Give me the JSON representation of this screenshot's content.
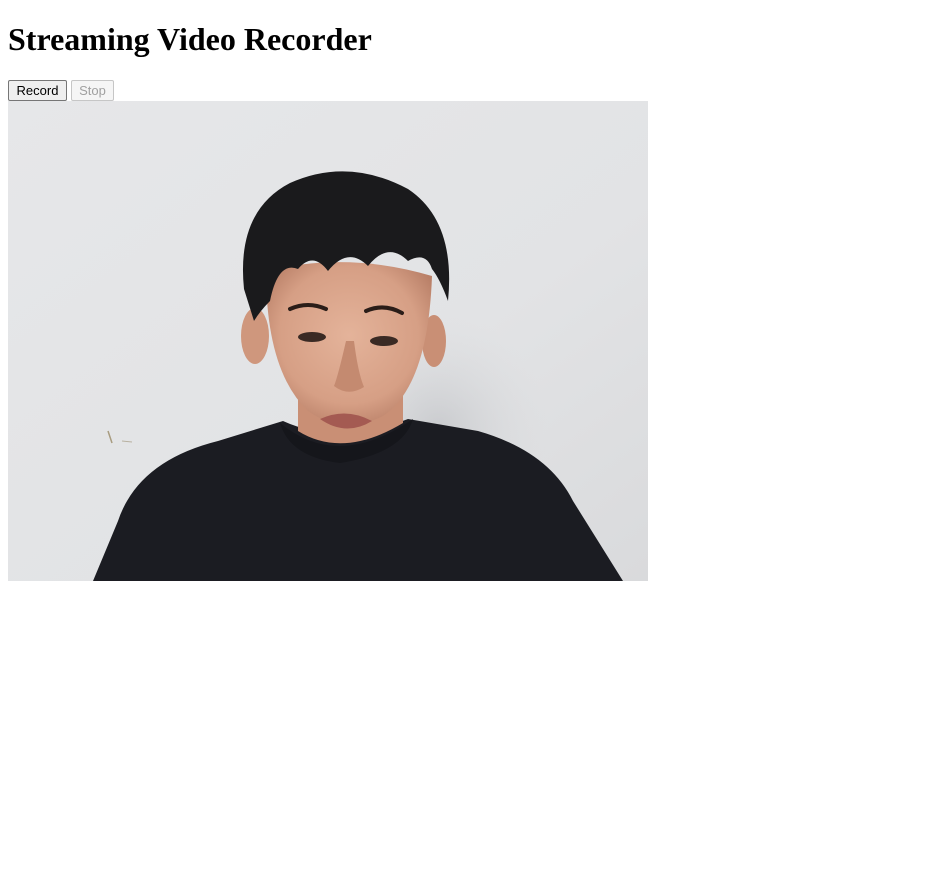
{
  "page": {
    "title": "Streaming Video Recorder"
  },
  "controls": {
    "record_label": "Record",
    "stop_label": "Stop",
    "stop_disabled": true
  },
  "video": {
    "content": "live webcam preview"
  },
  "colors": {
    "wall": "#e3e4e6",
    "shirt": "#1b1c22",
    "hair": "#1a1a1c",
    "skin": "#d9a58c"
  }
}
